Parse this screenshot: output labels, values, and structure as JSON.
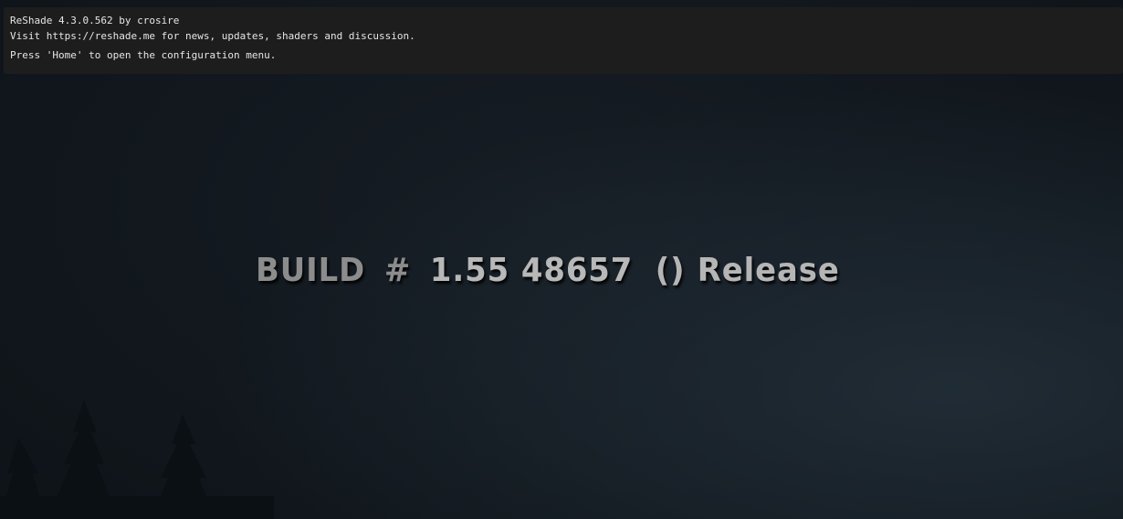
{
  "overlay": {
    "line1": "ReShade 4.3.0.562 by crosire",
    "line2": "Visit https://reshade.me for news, updates, shaders and discussion.",
    "line3": "Press 'Home' to open the configuration menu."
  },
  "build": {
    "label": "BUILD",
    "hash": "#",
    "version": "1.55 48657",
    "parens": "()",
    "release": "Release"
  },
  "colors": {
    "background": "#11171d",
    "overlay_bg": "#1e1e1e",
    "overlay_text": "#e6e6e6",
    "build_text": "#8c8c8c"
  }
}
